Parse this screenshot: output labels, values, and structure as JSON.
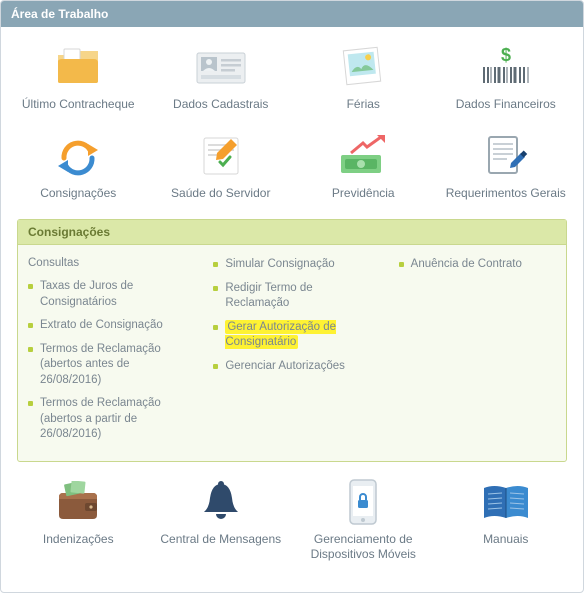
{
  "header": {
    "title": "Área de Trabalho"
  },
  "tiles": {
    "row1": [
      {
        "key": "ultimo-contracheque",
        "label": "Último Contracheque"
      },
      {
        "key": "dados-cadastrais",
        "label": "Dados Cadastrais"
      },
      {
        "key": "ferias",
        "label": "Férias"
      },
      {
        "key": "dados-financeiros",
        "label": "Dados Financeiros"
      }
    ],
    "row2": [
      {
        "key": "consignacoes",
        "label": "Consignações"
      },
      {
        "key": "saude-servidor",
        "label": "Saúde do Servidor"
      },
      {
        "key": "previdencia",
        "label": "Previdência"
      },
      {
        "key": "requerimentos-gerais",
        "label": "Requerimentos Gerais"
      }
    ],
    "row3": [
      {
        "key": "indenizacoes",
        "label": "Indenizações"
      },
      {
        "key": "central-mensagens",
        "label": "Central de Mensagens"
      },
      {
        "key": "ger-disp-moveis",
        "label": "Gerenciamento de Dispositivos Móveis"
      },
      {
        "key": "manuais",
        "label": "Manuais"
      }
    ]
  },
  "sub": {
    "title": "Consignações",
    "col1": {
      "header": "Consultas",
      "items": [
        "Taxas de Juros de Consignatários",
        "Extrato de Consignação",
        "Termos de Reclamação (abertos antes de 26/08/2016)",
        "Termos de Reclamação (abertos a partir de 26/08/2016)"
      ]
    },
    "col2": {
      "items": [
        "Simular Consignação",
        "Redigir Termo de Reclamação",
        "Gerar Autorização de Consignatário",
        "Gerenciar Autorizações"
      ],
      "highlight_index": 2
    },
    "col3": {
      "items": [
        "Anuência de Contrato"
      ]
    }
  }
}
